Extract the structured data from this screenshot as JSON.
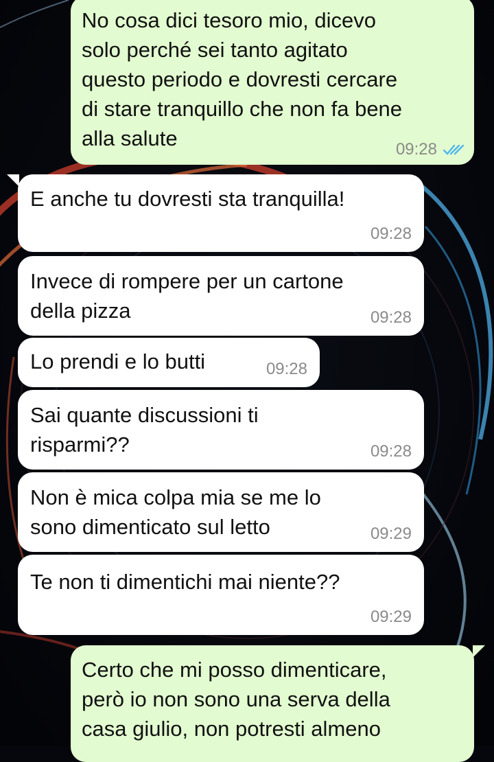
{
  "colors": {
    "incoming_bubble": "#ffffff",
    "outgoing_bubble": "#e2fbd0",
    "timestamp": "#8a8a8a",
    "read_ticks": "#4fb6ec"
  },
  "messages": [
    {
      "direction": "outgoing",
      "text": "No cosa dici tesoro mio, dicevo\nsolo perché sei tanto agitato\nquesto periodo e dovresti cercare\ndi stare tranquillo che non fa bene\nalla salute",
      "time": "09:28",
      "status_icon": "double-check-read-icon"
    },
    {
      "direction": "incoming",
      "text": "E anche tu dovresti sta tranquilla!",
      "time": "09:28"
    },
    {
      "direction": "incoming",
      "text": "Invece di rompere per un cartone\ndella pizza",
      "time": "09:28"
    },
    {
      "direction": "incoming",
      "text": "Lo prendi e lo butti",
      "time": "09:28"
    },
    {
      "direction": "incoming",
      "text": "Sai quante discussioni ti\nrisparmi??",
      "time": "09:28"
    },
    {
      "direction": "incoming",
      "text": "Non è mica colpa mia se me lo\nsono dimenticato sul letto",
      "time": "09:29"
    },
    {
      "direction": "incoming",
      "text": "Te non ti dimentichi mai niente??",
      "time": "09:29"
    },
    {
      "direction": "outgoing",
      "text": "Certo che mi posso dimenticare,\nperò io non sono una serva della\ncasa giulio, non potresti almeno",
      "time": ""
    }
  ]
}
